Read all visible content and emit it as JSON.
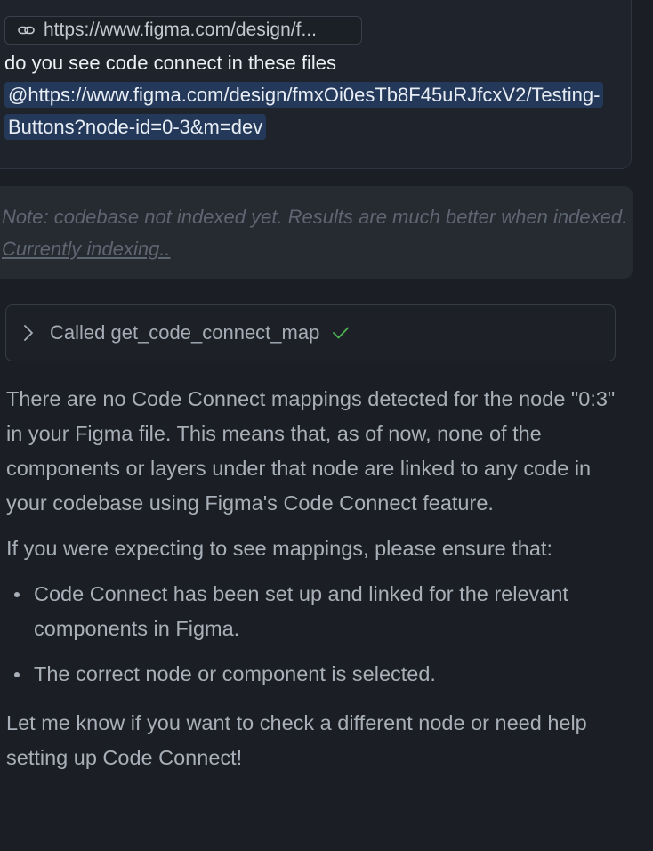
{
  "user_message": {
    "link_chip": {
      "icon": "link-icon",
      "label": "https://www.figma.com/design/f..."
    },
    "text_before_mention": "do you see code connect in these files",
    "mention": "@https://www.figma.com/design/fmxOi0esTb8F45uRJfcxV2/Testing-Buttons?node-id=0-3&m=dev"
  },
  "note": {
    "text": "Note: codebase not indexed yet. Results are much better when indexed.",
    "link_label": "Currently indexing.."
  },
  "tool_call": {
    "chevron_icon": "chevron-right-icon",
    "label": "Called get_code_connect_map",
    "status_icon": "check-icon",
    "status_color": "#4caf50"
  },
  "answer": {
    "paragraph1": "There are no Code Connect mappings detected for the node \"0:3\" in your Figma file. This means that, as of now, none of the components or layers under that node are linked to any code in your codebase using Figma's Code Connect feature.",
    "paragraph2": "If you were expecting to see mappings, please ensure that:",
    "bullets": [
      "Code Connect has been set up and linked for the relevant components in Figma.",
      "The correct node or component is selected."
    ],
    "paragraph3": "Let me know if you want to check a different node or need help setting up Code Connect!"
  }
}
